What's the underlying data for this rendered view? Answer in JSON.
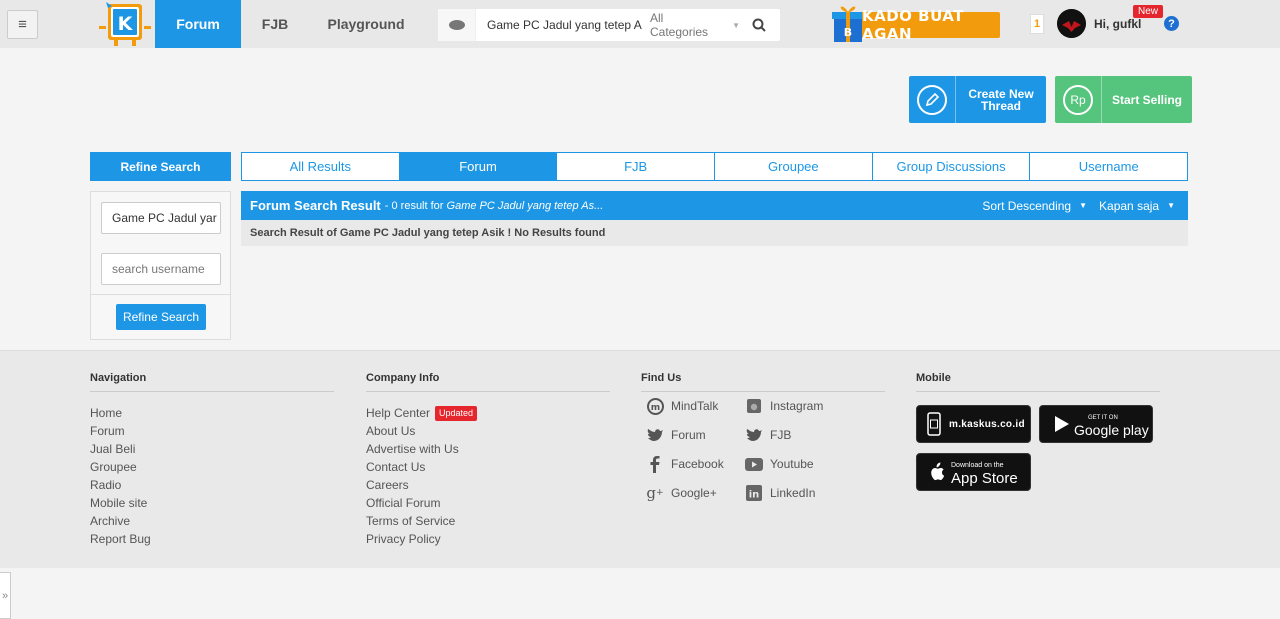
{
  "header": {
    "nav": [
      "Forum",
      "FJB",
      "Playground"
    ],
    "search": {
      "value": "Game PC Jadul yang tetep A",
      "category": "All Categories"
    },
    "promo": "KADO BUAT AGAN",
    "notif_count": "1",
    "greeting": "Hi, gufkl",
    "new_badge": "New",
    "help": "?"
  },
  "actions": {
    "create": "Create New Thread",
    "sell": "Start Selling",
    "sell_icon_text": "Rp"
  },
  "refine": {
    "title": "Refine Search",
    "keyword_value": "Game PC Jadul yar",
    "username_placeholder": "search username",
    "button": "Refine Search"
  },
  "result_tabs": [
    "All Results",
    "Forum",
    "FJB",
    "Groupee",
    "Group Discussions",
    "Username"
  ],
  "results": {
    "title": "Forum Search Result",
    "count_text": "- 0 result for",
    "query": "Game PC Jadul yang tetep As...",
    "sort": "Sort Descending",
    "time": "Kapan saja",
    "message": "Search Result of Game PC Jadul yang tetep Asik ! No Results found"
  },
  "footer": {
    "navigation": {
      "title": "Navigation",
      "links": [
        "Home",
        "Forum",
        "Jual Beli",
        "Groupee",
        "Radio",
        "Mobile site",
        "Archive",
        "Report Bug"
      ]
    },
    "company": {
      "title": "Company Info",
      "links": [
        "Help Center",
        "About Us",
        "Advertise with Us",
        "Contact Us",
        "Careers",
        "Official Forum",
        "Terms of Service",
        "Privacy Policy"
      ],
      "updated_badge": "Updated"
    },
    "find_us": {
      "title": "Find Us",
      "links": [
        "MindTalk",
        "Instagram",
        "Forum",
        "FJB",
        "Facebook",
        "Youtube",
        "Google+",
        "LinkedIn"
      ]
    },
    "mobile": {
      "title": "Mobile",
      "site": "m.kaskus.co.id",
      "google_small": "GET IT ON",
      "google": "Google play",
      "apple_small": "Download on the",
      "apple": "App Store"
    }
  },
  "side_toggle": "»"
}
